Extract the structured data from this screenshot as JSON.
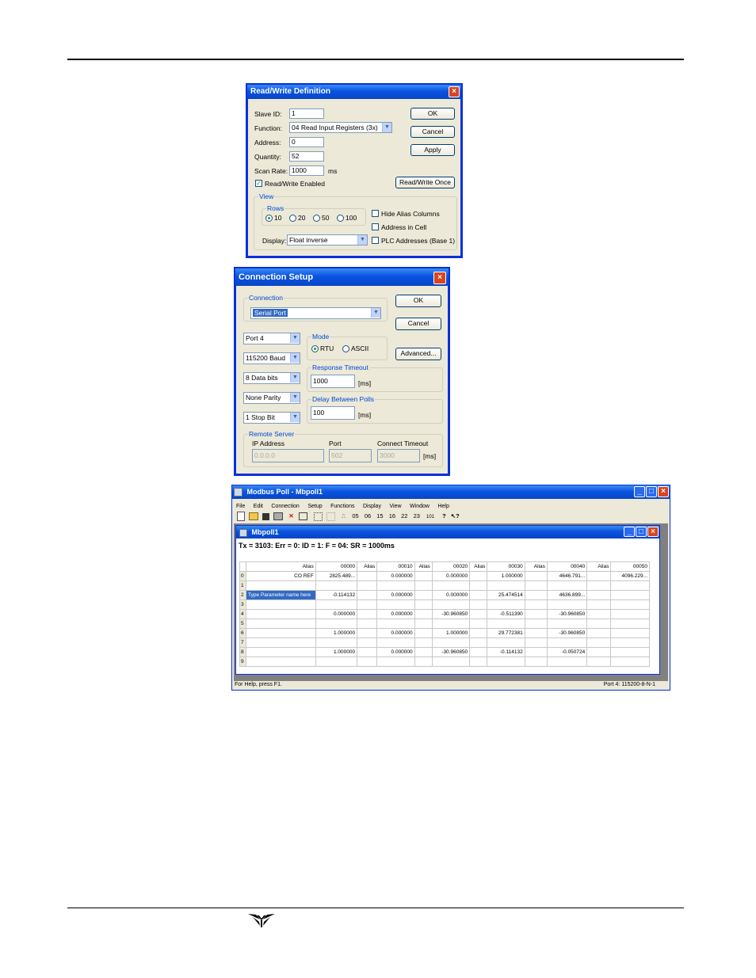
{
  "rw": {
    "title": "Read/Write Definition",
    "slave_label": "Slave ID:",
    "slave_value": "1",
    "function_label": "Function:",
    "function_value": "04 Read Input Registers (3x)",
    "address_label": "Address:",
    "address_value": "0",
    "quantity_label": "Quantity:",
    "quantity_value": "52",
    "scan_label": "Scan Rate:",
    "scan_value": "1000",
    "scan_unit": "ms",
    "rw_enabled_label": "Read/Write Enabled",
    "ok": "OK",
    "cancel": "Cancel",
    "apply": "Apply",
    "rw_once": "Read/Write Once",
    "view_label": "View",
    "rows_label": "Rows",
    "rows_options": [
      "10",
      "20",
      "50",
      "100"
    ],
    "hide_alias": "Hide Alias Columns",
    "address_in_cell": "Address in Cell",
    "plc_addresses": "PLC Addresses (Base 1)",
    "display_label": "Display:",
    "display_value": "Float inverse"
  },
  "cs": {
    "title": "Connection Setup",
    "connection_label": "Connection",
    "connection_value": "Serial Port",
    "ok": "OK",
    "cancel": "Cancel",
    "advanced": "Advanced...",
    "port": "Port 4",
    "baud": "115200 Baud",
    "data_bits": "8 Data bits",
    "parity": "None Parity",
    "stop_bits": "1 Stop Bit",
    "mode_label": "Mode",
    "mode_rtu": "RTU",
    "mode_ascii": "ASCII",
    "response_label": "Response Timeout",
    "response_value": "1000",
    "response_unit": "[ms]",
    "delay_label": "Delay Between Polls",
    "delay_value": "100",
    "delay_unit": "[ms]",
    "remote_label": "Remote Server",
    "ip_label": "IP Address",
    "ip_value": "0.0.0.0",
    "port_label": "Port",
    "port_value": "502",
    "ct_label": "Connect Timeout",
    "ct_value": "3000",
    "ct_unit": "[ms]"
  },
  "mp": {
    "title": "Modbus Poll - Mbpoll1",
    "menu": [
      "File",
      "Edit",
      "Connection",
      "Setup",
      "Functions",
      "Display",
      "View",
      "Window",
      "Help"
    ],
    "toolbar_nums": [
      "05",
      "06",
      "15",
      "16",
      "22",
      "23",
      "101"
    ],
    "child_title": "Mbpoll1",
    "status_line": "Tx = 3103: Err = 0: ID = 1: F = 04: SR = 1000ms",
    "headers": [
      "Alias",
      "00000",
      "Alias",
      "00010",
      "Alias",
      "00020",
      "Alias",
      "00030",
      "Alias",
      "00040",
      "Alias",
      "00050"
    ],
    "rows": [
      [
        "0",
        "CO REF",
        "2825.489...",
        "",
        "0.000000",
        "",
        "0.000000",
        "",
        "1.000000",
        "",
        "4646.791...",
        "",
        "4096.229..."
      ],
      [
        "1",
        "",
        "",
        "",
        "",
        "",
        "",
        "",
        "",
        "",
        "",
        "",
        ""
      ],
      [
        "2",
        "Type Parameter name here",
        "-0.114132",
        "",
        "0.000000",
        "",
        "0.000000",
        "",
        "25.474514",
        "",
        "4636.899...",
        "",
        ""
      ],
      [
        "3",
        "",
        "",
        "",
        "",
        "",
        "",
        "",
        "",
        "",
        "",
        "",
        ""
      ],
      [
        "4",
        "",
        "0.000000",
        "",
        "0.000000",
        "",
        "-30.960850",
        "",
        "-0.511390",
        "",
        "-30.960850",
        "",
        ""
      ],
      [
        "5",
        "",
        "",
        "",
        "",
        "",
        "",
        "",
        "",
        "",
        "",
        "",
        ""
      ],
      [
        "6",
        "",
        "1.000000",
        "",
        "0.000000",
        "",
        "1.000000",
        "",
        "29.772381",
        "",
        "-30.960850",
        "",
        ""
      ],
      [
        "7",
        "",
        "",
        "",
        "",
        "",
        "",
        "",
        "",
        "",
        "",
        "",
        ""
      ],
      [
        "8",
        "",
        "1.000000",
        "",
        "0.000000",
        "",
        "-30.960850",
        "",
        "-0.114132",
        "",
        "-0.050724",
        "",
        ""
      ],
      [
        "9",
        "",
        "",
        "",
        "",
        "",
        "",
        "",
        "",
        "",
        "",
        "",
        ""
      ]
    ],
    "status_left": "For Help, press F1.",
    "status_right": "Port 4: 115200-8-N-1"
  }
}
